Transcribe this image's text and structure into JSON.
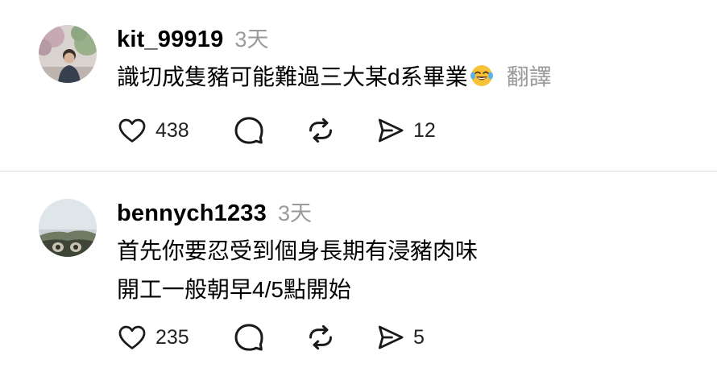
{
  "posts": [
    {
      "username": "kit_99919",
      "time": "3天",
      "avatar_icon": "user-photo-person-tree",
      "lines": [
        "識切成隻豬可能難過三大某d系畢業"
      ],
      "emoji": "face-with-tears-of-joy",
      "translate_label": "翻譯",
      "likes": "438",
      "shares": "12"
    },
    {
      "username": "bennych1233",
      "time": "3天",
      "avatar_icon": "user-photo-landscape",
      "lines": [
        "首先你要忍受到個身長期有浸豬肉味",
        "開工一般朝早4/5點開始"
      ],
      "likes": "235",
      "shares": "5"
    }
  ],
  "colors": {
    "text": "#000000",
    "muted": "#9a9a9a",
    "divider": "#dcdcdc",
    "background": "#ffffff"
  }
}
